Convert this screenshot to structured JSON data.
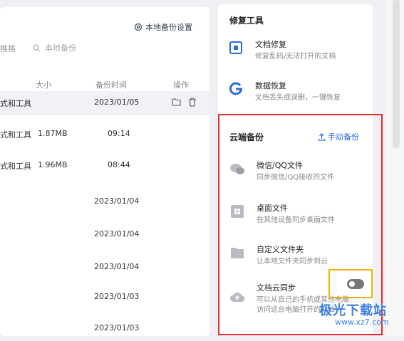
{
  "left": {
    "settings_label": "本地备份设置",
    "tab_label": "推格",
    "search_placeholder": "本地备份",
    "columns": {
      "size": "大小",
      "time": "备份时间",
      "action": "操作"
    },
    "rows": [
      {
        "name": "式和工具",
        "size": "",
        "time": "2023/01/05"
      },
      {
        "name": "式和工具",
        "size": "1.87MB",
        "time": "09:14"
      },
      {
        "name": "式和工具",
        "size": "1.96MB",
        "time": "08:44"
      },
      {
        "name": "",
        "size": "",
        "time": "2023/01/04"
      },
      {
        "name": "",
        "size": "",
        "time": "2023/01/04"
      },
      {
        "name": "",
        "size": "",
        "time": "2023/01/04"
      },
      {
        "name": "",
        "size": "",
        "time": "2023/01/03"
      },
      {
        "name": "",
        "size": "",
        "time": "2023/01/03"
      }
    ]
  },
  "repair": {
    "title": "修复工具",
    "items": [
      {
        "title": "文档修复",
        "desc": "修复乱码/无法打开的文档",
        "icon": "doc-repair-icon"
      },
      {
        "title": "数据恢复",
        "desc": "文档丢失或误删，一键恢复",
        "icon": "data-recovery-icon"
      }
    ]
  },
  "cloud": {
    "title": "云端备份",
    "manual_label": "手动备份",
    "items": [
      {
        "title": "微信/QQ文件",
        "desc": "同步微信/QQ接收的文件",
        "icon": "wechat-icon"
      },
      {
        "title": "桌面文件",
        "desc": "在其他设备同步桌面文件",
        "icon": "desktop-icon"
      },
      {
        "title": "自定义文件夹",
        "desc": "让本地文件夹同步到云",
        "icon": "folder-icon"
      },
      {
        "title": "文档云同步",
        "desc": "可以从自己的手机或其他电脑",
        "desc2": "访问这台电脑打开的文档",
        "icon": "cloud-upload-icon",
        "toggle_on": false
      }
    ]
  },
  "watermark": {
    "brand": "极光下载站",
    "url": "www.xz7.com"
  },
  "colors": {
    "highlight_red": "#e22c2c",
    "highlight_yellow": "#f2b300",
    "link_blue": "#2a6be0"
  }
}
